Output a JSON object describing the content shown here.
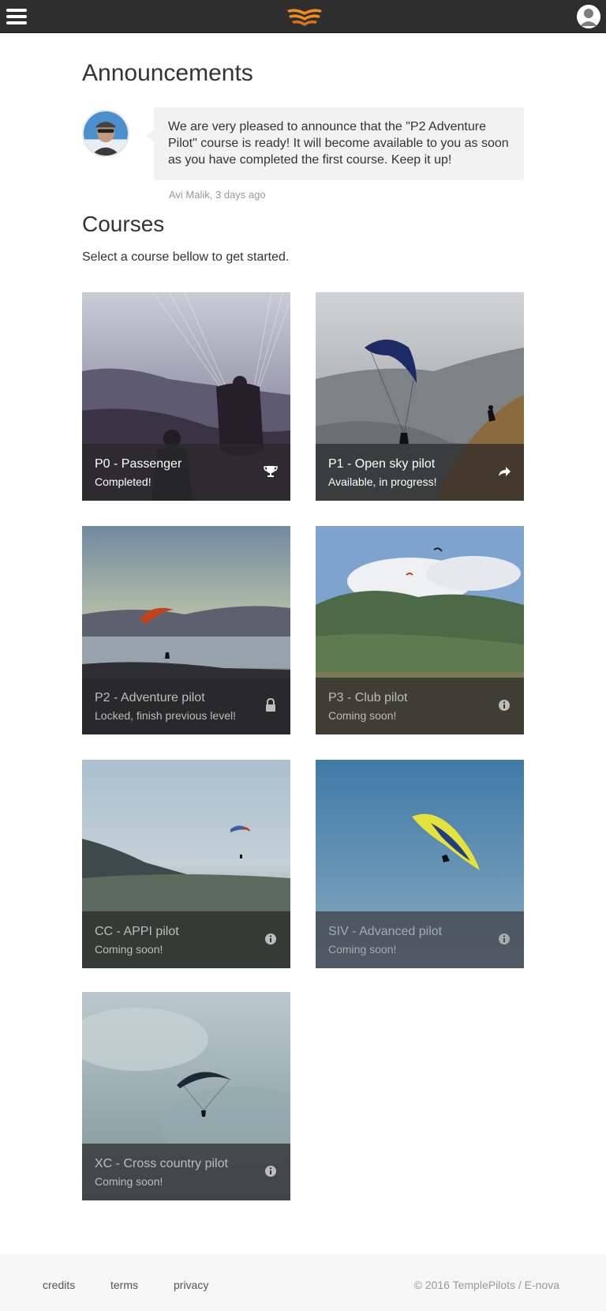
{
  "announcements": {
    "heading": "Announcements",
    "message": "We are very pleased to announce that the \"P2 Adventure Pilot\" course is ready! It will become available to you as soon as you have completed the first course. Keep it up!",
    "meta": "Avi Malik, 3 days ago"
  },
  "courses": {
    "heading": "Courses",
    "subtitle": "Select a course bellow to get started.",
    "items": [
      {
        "title": "P0 - Passenger",
        "status": "Completed!",
        "icon": "trophy-icon"
      },
      {
        "title": "P1 - Open sky pilot",
        "status": "Available, in progress!",
        "icon": "share-arrow-icon"
      },
      {
        "title": "P2 - Adventure pilot",
        "status": "Locked, finish previous level!",
        "icon": "lock-icon"
      },
      {
        "title": "P3 - Club pilot",
        "status": "Coming soon!",
        "icon": "info-icon"
      },
      {
        "title": "CC - APPI pilot",
        "status": "Coming soon!",
        "icon": "info-icon"
      },
      {
        "title": "SIV - Advanced pilot",
        "status": "Coming soon!",
        "icon": "info-icon"
      },
      {
        "title": "XC - Cross country pilot",
        "status": "Coming soon!",
        "icon": "info-icon"
      }
    ]
  },
  "footer": {
    "links": [
      "credits",
      "terms",
      "privacy"
    ],
    "copyright": "© 2016 TemplePilots / E-nova"
  },
  "colors": {
    "topbar": "#2e2e2e",
    "logo_orange": "#f08a24",
    "bubble": "#f2f2f2",
    "footer": "#f6f6f6"
  }
}
